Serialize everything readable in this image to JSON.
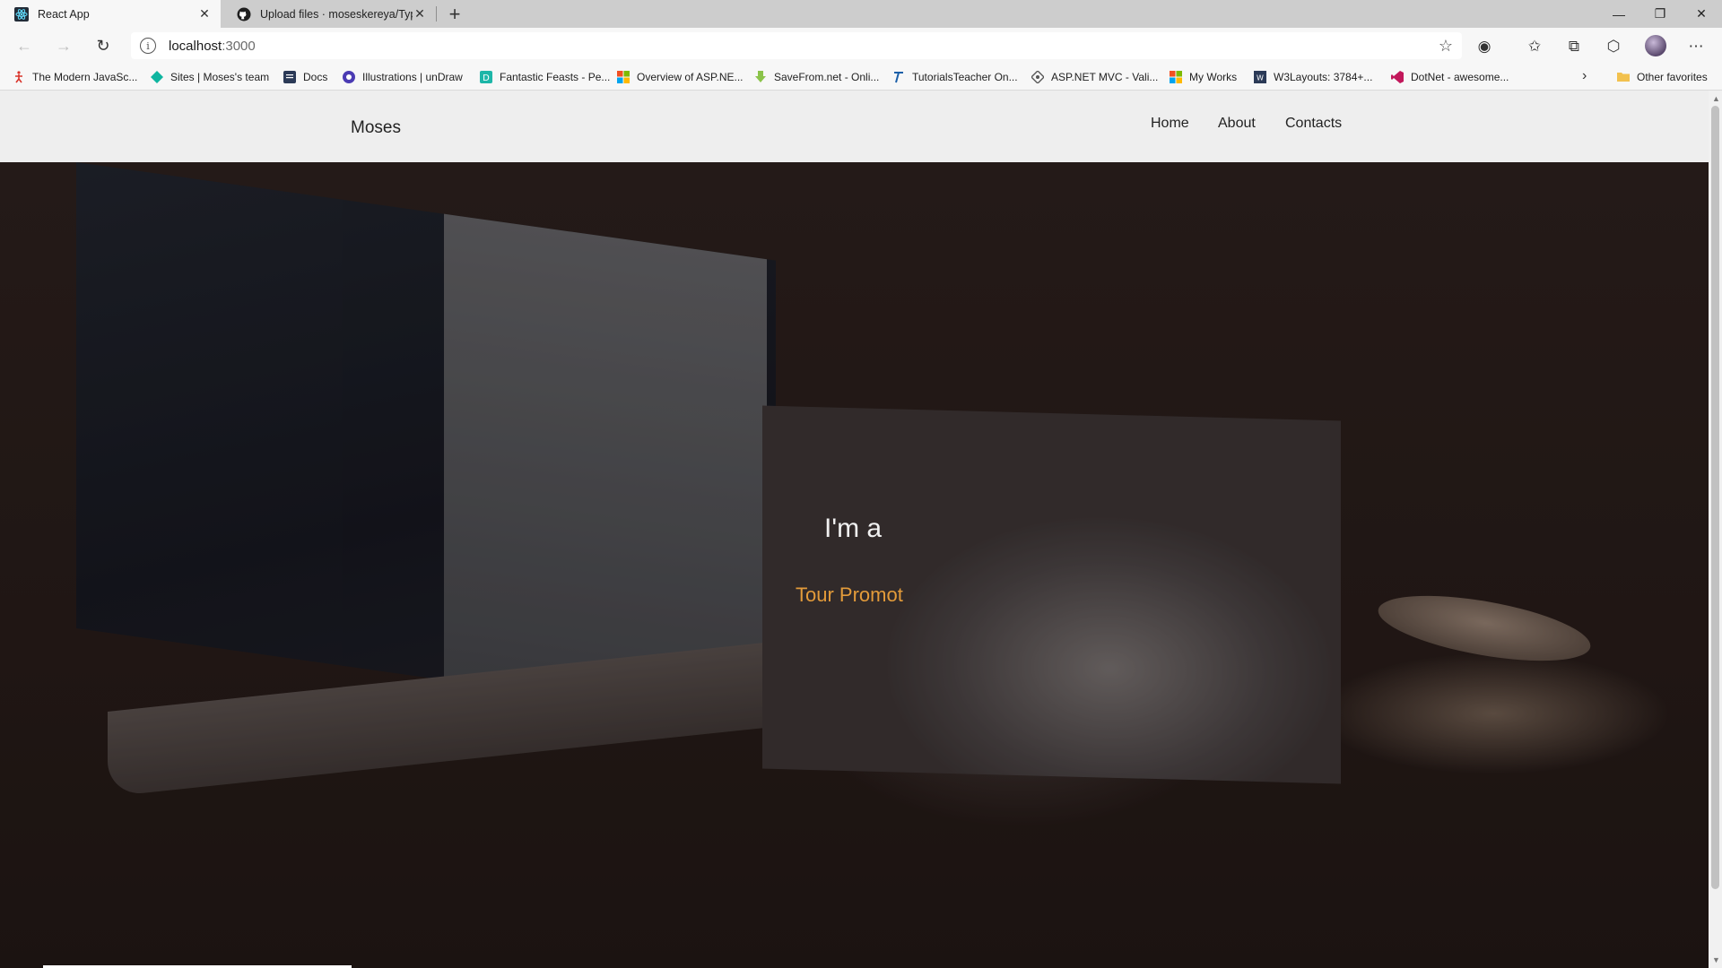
{
  "browser": {
    "tabs": [
      {
        "title": "React App",
        "active": true,
        "icon": "react-icon"
      },
      {
        "title": "Upload files · moseskereya/Typo",
        "active": false,
        "icon": "github-icon"
      }
    ],
    "address": {
      "host": "localhost",
      "port": ":3000"
    },
    "bookmarks": [
      {
        "label": "The Modern JavaSc...",
        "icon": "figure-icon",
        "color": "#d9342b"
      },
      {
        "label": "Sites | Moses's team",
        "icon": "diamond-icon",
        "color": "#0fb5a0"
      },
      {
        "label": "Docs",
        "icon": "docs-icon",
        "color": "#2b3a57"
      },
      {
        "label": "Illustrations | unDraw",
        "icon": "undraw-icon",
        "color": "#4b3bb3"
      },
      {
        "label": "Fantastic Feasts - Pe...",
        "icon": "page-icon",
        "color": "#1db6a8"
      },
      {
        "label": "Overview of ASP.NE...",
        "icon": "microsoft-icon",
        "color": "#f25022"
      },
      {
        "label": "SaveFrom.net - Onli...",
        "icon": "download-icon",
        "color": "#8bc34a"
      },
      {
        "label": "TutorialsTeacher On...",
        "icon": "tt-icon",
        "color": "#1b5fa8"
      },
      {
        "label": "ASP.NET MVC - Vali...",
        "icon": "aspnet-icon",
        "color": "#555555"
      },
      {
        "label": "My Works",
        "icon": "microsoft-icon",
        "color": "#f25022"
      },
      {
        "label": "W3Layouts: 3784+...",
        "icon": "w3-icon",
        "color": "#2b3a57"
      },
      {
        "label": "DotNet - awesome...",
        "icon": "vs-icon",
        "color": "#c2185b"
      }
    ],
    "other_favorites": "Other favorites"
  },
  "site": {
    "brand": "Moses",
    "nav": [
      "Home",
      "About",
      "Contacts"
    ],
    "hero": {
      "intro": "I'm a",
      "role": "Tour Promot",
      "role_color": "#e39b3a"
    }
  }
}
